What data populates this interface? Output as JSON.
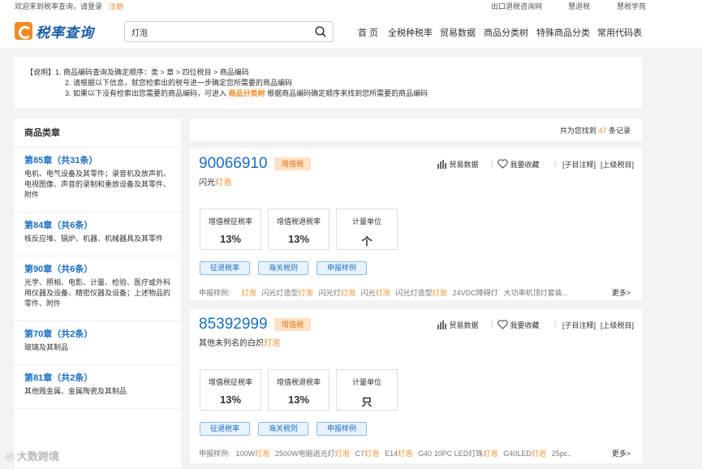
{
  "topbar": {
    "welcome": "欢迎来到税率查询，请登录",
    "register": "注册",
    "links": [
      "出口退税咨询网",
      "慧退税",
      "慧税学苑"
    ]
  },
  "header": {
    "logo": "税率查询",
    "search_value": "灯泡",
    "nav": [
      "首 页",
      "全税种税率",
      "贸易数据",
      "商品分类树",
      "特殊商品分类",
      "常用代码表"
    ]
  },
  "explain": {
    "line1": "【说明】1. 商品编码查询及确定顺序：类 > 章 > 四位税目 > 商品编码",
    "line2": "2. 请根据以下信息，就您检索出的税号进一步确定您所需要的商品编码",
    "line3_pre": "3. 如果以下没有检索出您需要的商品编码，可进入",
    "line3_link": "商品分类树",
    "line3_post": "根据商品编码确定顺序来找到您所需要的商品编码"
  },
  "sidebar": {
    "title": "商品类章",
    "cats": [
      {
        "t": "第85章（共31条）",
        "d": "电机、电气设备及其零件；录音机及放声机、电视图像、声音的录制和重放设备及其零件、附件"
      },
      {
        "t": "第84章（共6条）",
        "d": "核反应堆、锅炉、机器、机械器具及其零件"
      },
      {
        "t": "第90章（共6条）",
        "d": "光学、照相、电影、计量、检验、医疗或外科用仪器及设备、精密仪器及设备；上述物品的零件、附件"
      },
      {
        "t": "第70章（共2条）",
        "d": "玻璃及其制品"
      },
      {
        "t": "第81章（共2条）",
        "d": "其他贱金属、金属陶瓷及其制品"
      }
    ]
  },
  "count": {
    "pre": "共为您找到",
    "num": "47",
    "post": "条记录"
  },
  "common": {
    "tag": "增值税",
    "trade": "贸易数据",
    "fav": "我要收藏",
    "sub": "[子目注释]",
    "upper": "[上级税目]",
    "l1": "增值税征税率",
    "l2": "增值税退税率",
    "l3": "计量单位",
    "b1": "征退税率",
    "b2": "海关税则",
    "b3": "申报样例",
    "ex_label": "申报样例:",
    "more": "更多>"
  },
  "results": [
    {
      "code": "90066910",
      "name_pre": "闪光",
      "name_hl": "灯泡",
      "levy": "13%",
      "refund": "13%",
      "unit": "个",
      "ex": [
        [
          "",
          ""
        ],
        [
          "",
          "灯泡"
        ],
        [
          "闪光灯造型",
          "灯泡"
        ],
        [
          "闪光灯",
          "灯泡"
        ],
        [
          "闪光",
          "灯泡"
        ],
        [
          "闪光灯造型",
          "灯泡"
        ],
        [
          "24VDC障碍灯",
          ""
        ],
        [
          "大功率机顶灯套装...",
          ""
        ]
      ]
    },
    {
      "code": "85392999",
      "name_pre": "其他未列名的白炽",
      "name_hl": "灯泡",
      "levy": "13%",
      "refund": "13%",
      "unit": "只",
      "ex": [
        [
          "100W",
          "灯泡"
        ],
        [
          "2500W电脑追光灯",
          "灯泡"
        ],
        [
          "C7",
          "灯泡"
        ],
        [
          "E14",
          "灯泡"
        ],
        [
          "G40 10PC LED灯珠",
          "灯泡"
        ],
        [
          "G40LED",
          "灯泡"
        ],
        [
          "25pc...",
          ""
        ]
      ]
    }
  ],
  "watermark": "大数跨境"
}
